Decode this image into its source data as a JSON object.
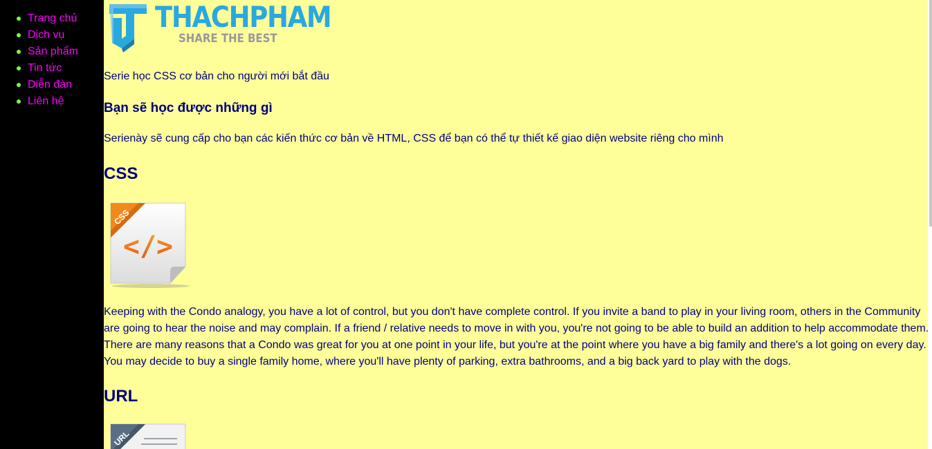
{
  "nav": {
    "items": [
      {
        "label": "Trang chủ"
      },
      {
        "label": "Dịch vụ"
      },
      {
        "label": "Sản phẩm"
      },
      {
        "label": "Tin tức"
      },
      {
        "label": "Diễn đàn"
      },
      {
        "label": "Liên hệ"
      }
    ]
  },
  "logo": {
    "title": "THACHPHAM",
    "tagline": "SHARE THE BEST"
  },
  "content": {
    "intro": "Serie học CSS cơ bản cho người mới bắt đầu",
    "subheading": "Bạn sẽ học được những gì",
    "description": "Serienày sẽ cung cấp cho bạn các kiến thức cơ bản về HTML, CSS để bạn có thể tự thiết kế giao diện website riêng cho mình",
    "css_heading": "CSS",
    "css_icon_tag": "CSS",
    "css_icon_glyph": "</>",
    "paragraph": "Keeping with the Condo analogy, you have a lot of control, but you don't have complete control. If you invite a band to play in your living room, others in the Community are going to hear the noise and may complain. If a friend / relative needs to move in with you, you're not going to be able to build an addition to help accommodate them. There are many reasons that a Condo was great for you at one point in your life, but you're at the point where you have a big family and there's a lot going on every day. You may decide to buy a single family home, where you'll have plenty of parking, extra bathrooms, and a big back yard to play with the dogs.",
    "url_heading": "URL",
    "url_icon_tag": "URL"
  },
  "colors": {
    "page_background": "#ffff99",
    "sidebar_background": "#000000",
    "nav_link": "#ff00ff",
    "nav_bullet": "#7cfc3c",
    "text": "#000080",
    "logo_primary": "#2aa8e0",
    "logo_secondary": "#999999"
  }
}
